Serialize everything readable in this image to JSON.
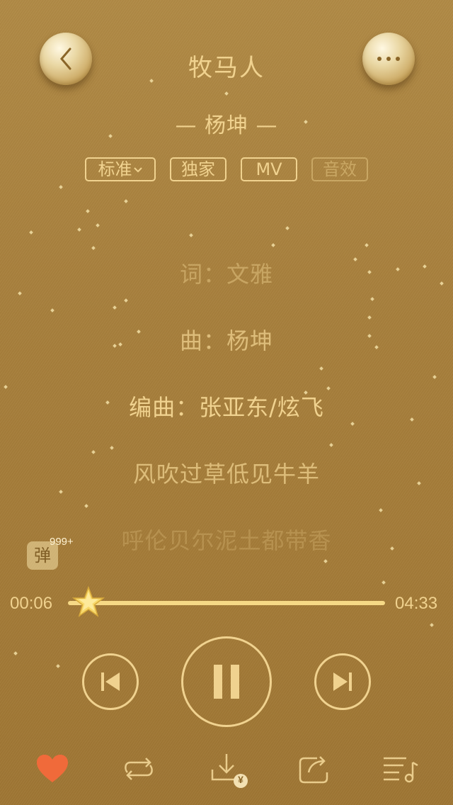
{
  "header": {
    "title": "牧马人",
    "artist": "— 杨坤 —",
    "back_icon": "chevron-left-icon",
    "more_icon": "more-dots-icon"
  },
  "tags": [
    {
      "label": "标准",
      "icon": "chevron-down-icon"
    },
    {
      "label": "独家"
    },
    {
      "label": "MV"
    },
    {
      "label": "音效"
    }
  ],
  "lyrics": [
    "词：文雅",
    "曲：杨坤",
    "编曲：张亚东/炫飞",
    "风吹过草低见牛羊",
    "呼伦贝尔泥土都带香"
  ],
  "danmu": {
    "label": "弹",
    "count": "999+"
  },
  "progress": {
    "current": "00:06",
    "total": "04:33",
    "fraction": 0.022
  },
  "controls": {
    "prev_icon": "previous-track-icon",
    "play_state": "playing",
    "pause_icon": "pause-icon",
    "next_icon": "next-track-icon"
  },
  "bottom_bar": {
    "favorite_icon": "heart-icon",
    "favorite_color": "#f06a3a",
    "loop_icon": "repeat-icon",
    "download_icon": "download-paid-icon",
    "download_badge": "¥",
    "share_icon": "share-icon",
    "playlist_icon": "playlist-icon"
  },
  "colors": {
    "accent": "#f0d28f",
    "track": "#f6d986"
  }
}
